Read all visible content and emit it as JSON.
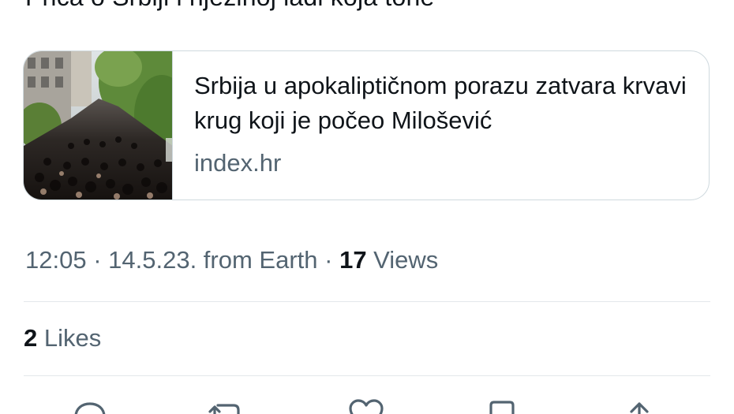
{
  "tweet": {
    "partial_text": "Priča o Srbiji i njezinoj lađi koja tone"
  },
  "link_card": {
    "title": "Srbija u apokaliptičnom porazu zatvara krvavi krug koji je počeo Milošević",
    "domain": "index.hr",
    "image": "protest-crowd-street-photo"
  },
  "meta": {
    "time": "12:05",
    "sep1": " · ",
    "date": "14.5.23.",
    "source": " from Earth",
    "sep2": " · ",
    "views_count": "17",
    "views_label": " Views"
  },
  "engagement": {
    "likes_count": "2",
    "likes_label": " Likes"
  },
  "actions": {
    "icons": [
      "reply-icon",
      "retweet-icon",
      "like-icon",
      "bookmark-icon",
      "share-icon"
    ]
  },
  "colors": {
    "text_primary": "#0f1419",
    "text_secondary": "#536471",
    "border": "#cfd9de",
    "divider": "#e3e8eb"
  }
}
